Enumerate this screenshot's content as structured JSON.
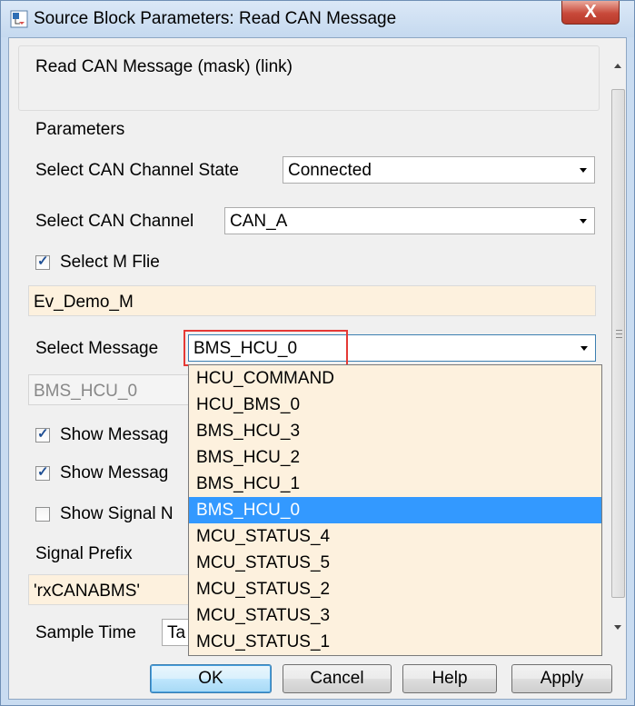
{
  "window": {
    "title": "Source Block Parameters: Read CAN Message",
    "close_label": "X"
  },
  "header": {
    "title": "Read CAN Message (mask) (link)"
  },
  "parameters": {
    "group_label": "Parameters",
    "channel_state": {
      "label": "Select CAN Channel State",
      "value": "Connected"
    },
    "channel": {
      "label": "Select CAN Channel",
      "value": "CAN_A"
    },
    "select_m_file": {
      "label": "Select M Flie",
      "checked": true
    },
    "m_file_value": "Ev_Demo_M",
    "message": {
      "label": "Select Message",
      "value": "BMS_HCU_0"
    },
    "message_readonly": "BMS_HCU_0",
    "show_message_1": {
      "label": "Show Messag",
      "checked": true
    },
    "show_message_2": {
      "label": "Show Messag",
      "checked": true
    },
    "show_signal": {
      "label": "Show Signal N",
      "checked": false
    },
    "signal_prefix": {
      "label": "Signal Prefix",
      "value": "'rxCANABMS'"
    },
    "sample_time": {
      "label": "Sample Time",
      "value": "Ta"
    }
  },
  "dropdown": {
    "options": [
      "HCU_COMMAND",
      "HCU_BMS_0",
      "BMS_HCU_3",
      "BMS_HCU_2",
      "BMS_HCU_1",
      "BMS_HCU_0",
      "MCU_STATUS_4",
      "MCU_STATUS_5",
      "MCU_STATUS_2",
      "MCU_STATUS_3",
      "MCU_STATUS_1"
    ],
    "selected": "BMS_HCU_0"
  },
  "buttons": {
    "ok": "OK",
    "cancel": "Cancel",
    "help": "Help",
    "apply": "Apply"
  },
  "colors": {
    "selection": "#3399ff",
    "highlight_outline": "#e53935",
    "field_background": "#fdf1de",
    "close_button": "#c8493a"
  }
}
